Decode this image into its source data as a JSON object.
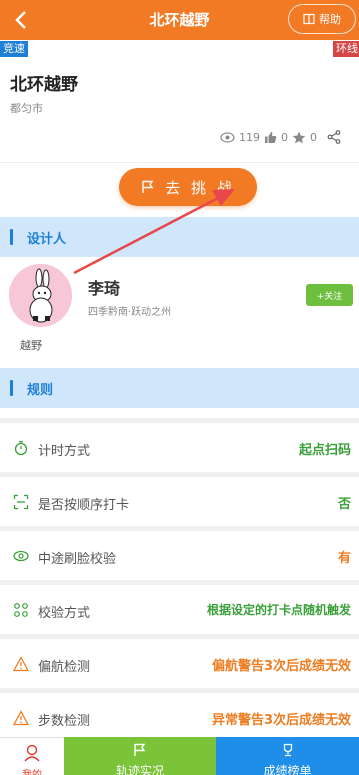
{
  "header": {
    "title": "北环越野",
    "help_label": "帮助"
  },
  "tags": {
    "left": "竞速",
    "right": "环线"
  },
  "route": {
    "name": "北环越野",
    "city": "都匀市",
    "views": "119",
    "likes": "0",
    "stars": "0"
  },
  "challenge_label": "去 挑 战",
  "designer_section": "设计人",
  "designer": {
    "name": "李琦",
    "subtitle": "四季黔南·跃动之州",
    "follow_label": "+关注",
    "handle": "越野"
  },
  "rules_section": "规则",
  "rules": [
    {
      "label": "计时方式",
      "value": "起点扫码",
      "color": "#3aa13a"
    },
    {
      "label": "是否按顺序打卡",
      "value": "否",
      "color": "#3aa13a"
    },
    {
      "label": "中途刷脸校验",
      "value": "有",
      "color": "#ee7d22"
    },
    {
      "label": "校验方式",
      "value": "根据设定的打卡点随机触发",
      "color": "#3aa13a"
    },
    {
      "label": "偏航检测",
      "value": "偏航警告3次后成绩无效",
      "color": "#ee7d22"
    },
    {
      "label": "步数检测",
      "value": "异常警告3次后成绩无效",
      "color": "#ee7d22"
    }
  ],
  "bottom_nav": {
    "me": "我的",
    "track": "轨迹实况",
    "rank": "成绩榜单"
  },
  "colors": {
    "primary": "#f27a25",
    "blue": "#1e7fd6",
    "green": "#7bc43a"
  }
}
